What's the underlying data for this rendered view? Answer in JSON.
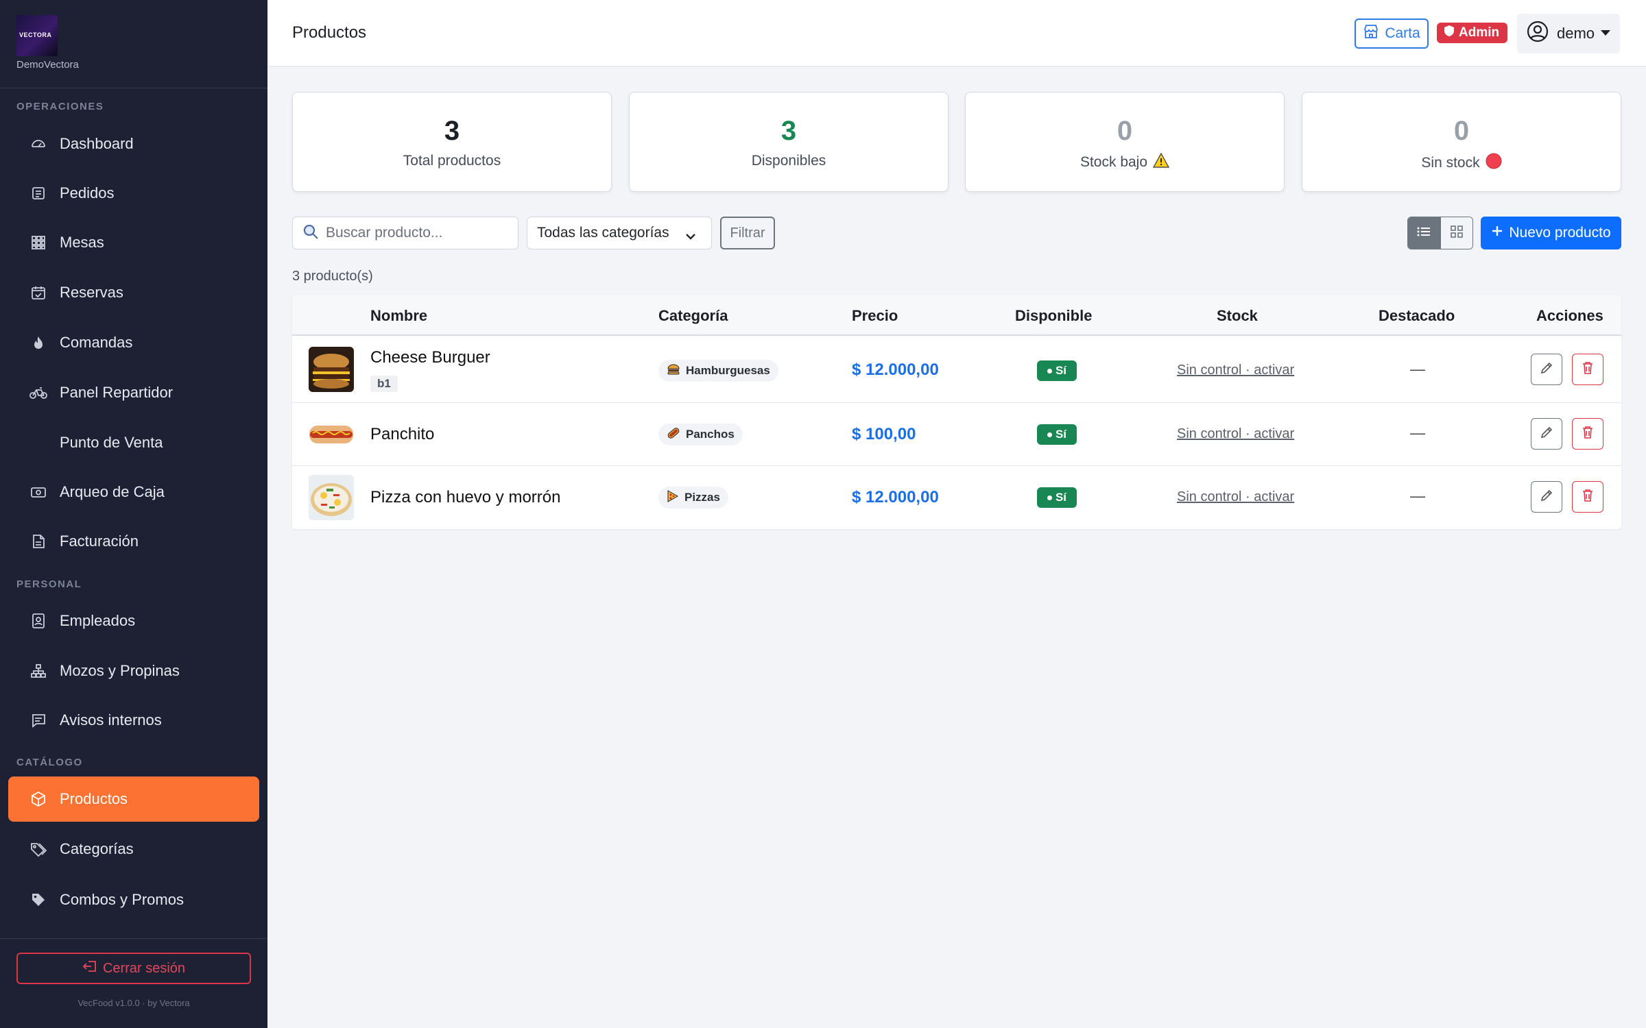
{
  "brand": {
    "logo_text": "VECTORA",
    "name": "DemoVectora"
  },
  "sidebar": {
    "sections": [
      {
        "title": "OPERACIONES"
      },
      {
        "title": "PERSONAL"
      },
      {
        "title": "CATÁLOGO"
      }
    ],
    "items": [
      {
        "label": "Dashboard",
        "icon": "speedometer-icon"
      },
      {
        "label": "Pedidos",
        "icon": "receipt-icon"
      },
      {
        "label": "Mesas",
        "icon": "grid-icon"
      },
      {
        "label": "Reservas",
        "icon": "calendar-check-icon"
      },
      {
        "label": "Comandas",
        "icon": "fire-icon"
      },
      {
        "label": "Panel Repartidor",
        "icon": "bicycle-icon"
      },
      {
        "label": "Punto de Venta",
        "icon": ""
      },
      {
        "label": "Arqueo de Caja",
        "icon": "cash-icon"
      },
      {
        "label": "Facturación",
        "icon": "file-text-icon"
      },
      {
        "label": "Empleados",
        "icon": "person-badge-icon"
      },
      {
        "label": "Mozos y Propinas",
        "icon": "diagram-icon"
      },
      {
        "label": "Avisos internos",
        "icon": "chat-icon"
      },
      {
        "label": "Productos",
        "icon": "box-icon",
        "active": true
      },
      {
        "label": "Categorías",
        "icon": "tags-icon"
      },
      {
        "label": "Combos y Promos",
        "icon": "tag-icon"
      }
    ],
    "logout_label": "Cerrar sesión",
    "version": "VecFood v1.0.0 · by Vectora"
  },
  "header": {
    "title": "Productos",
    "carta_label": "Carta",
    "admin_label": "Admin",
    "user_label": "demo"
  },
  "stats": [
    {
      "value": "3",
      "label": "Total productos",
      "color": "#1d1f26"
    },
    {
      "value": "3",
      "label": "Disponibles",
      "color": "#198754"
    },
    {
      "value": "0",
      "label": "Stock bajo",
      "color": "#9aa0aa",
      "icon": "warning-icon"
    },
    {
      "value": "0",
      "label": "Sin stock",
      "color": "#9aa0aa",
      "icon": "red-circle-icon"
    }
  ],
  "toolbar": {
    "search_placeholder": "Buscar producto...",
    "category_selected": "Todas las categorías",
    "filter_label": "Filtrar",
    "new_label": "Nuevo producto"
  },
  "count_text": "3 producto(s)",
  "table": {
    "columns": [
      "Nombre",
      "Categoría",
      "Precio",
      "Disponible",
      "Stock",
      "Destacado",
      "Acciones"
    ],
    "rows": [
      {
        "name": "Cheese Burguer",
        "sku": "b1",
        "category": "Hamburguesas",
        "category_icon": "burger-icon",
        "price": "$ 12.000,00",
        "available": "Sí",
        "stock": "Sin control · activar",
        "featured": "—",
        "thumb": "burger"
      },
      {
        "name": "Panchito",
        "sku": "",
        "category": "Panchos",
        "category_icon": "hotdog-icon",
        "price": "$ 100,00",
        "available": "Sí",
        "stock": "Sin control · activar",
        "featured": "—",
        "thumb": "hotdog"
      },
      {
        "name": "Pizza con huevo y morrón",
        "sku": "",
        "category": "Pizzas",
        "category_icon": "pizza-icon",
        "price": "$ 12.000,00",
        "available": "Sí",
        "stock": "Sin control · activar",
        "featured": "—",
        "thumb": "pizza"
      }
    ]
  },
  "colors": {
    "sidebar_bg": "#1e2133",
    "accent": "#fb7233",
    "primary": "#0d6efd",
    "danger": "#dc3545",
    "success": "#198754"
  }
}
